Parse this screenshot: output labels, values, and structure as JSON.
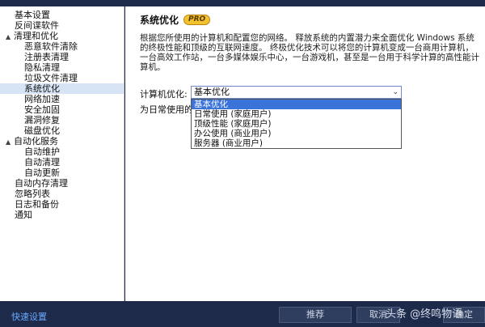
{
  "sidebar": {
    "items": [
      {
        "label": "基本设置",
        "level": 0
      },
      {
        "label": "反间谍软件",
        "level": 0
      },
      {
        "label": "清理和优化",
        "level": 0,
        "group": true
      },
      {
        "label": "恶意软件清除",
        "level": 1
      },
      {
        "label": "注册表清理",
        "level": 1
      },
      {
        "label": "隐私清理",
        "level": 1
      },
      {
        "label": "垃圾文件清理",
        "level": 1
      },
      {
        "label": "系统优化",
        "level": 1,
        "selected": true
      },
      {
        "label": "网络加速",
        "level": 1
      },
      {
        "label": "安全加固",
        "level": 1
      },
      {
        "label": "漏洞修复",
        "level": 1
      },
      {
        "label": "磁盘优化",
        "level": 1
      },
      {
        "label": "自动化服务",
        "level": 0,
        "group": true
      },
      {
        "label": "自动维护",
        "level": 1
      },
      {
        "label": "自动清理",
        "level": 1
      },
      {
        "label": "自动更新",
        "level": 1
      },
      {
        "label": "自动内存清理",
        "level": 0
      },
      {
        "label": "忽略列表",
        "level": 0
      },
      {
        "label": "日志和备份",
        "level": 0
      },
      {
        "label": "通知",
        "level": 0
      }
    ],
    "toggle_glyph": "▲"
  },
  "main": {
    "title": "系统优化",
    "badge": "PRO",
    "description": "根据您所使用的计算机和配置您的网络。 释放系统的内置潜力来全面优化 Windows 系统的终极性能和顶级的互联网速度。 终极优化技术可以将您的计算机变成一台商用计算机，一台高效工作站，一台多媒体娱乐中心，一台游戏机，甚至是一台用于科学计算的高性能计算机。",
    "optimize_label": "计算机优化:",
    "selected_value": "基本优化",
    "options": [
      "基本优化",
      "日常使用 (家庭用户)",
      "顶级性能 (家庭用户)",
      "办公使用 (商业用户)",
      "服务器 (商业用户)"
    ],
    "hint": "为日常使用的",
    "arrow_glyph": "⌄"
  },
  "bottom": {
    "quick_settings": "快速设置",
    "recommend": "推荐",
    "cancel": "取消",
    "ok": "确定"
  },
  "watermark": "头条 @终鸣物语",
  "colors": {
    "accent": "#3a73d9",
    "badge": "#f2c230",
    "chrome": "#1d2a4a",
    "link": "#6aa9ff"
  }
}
